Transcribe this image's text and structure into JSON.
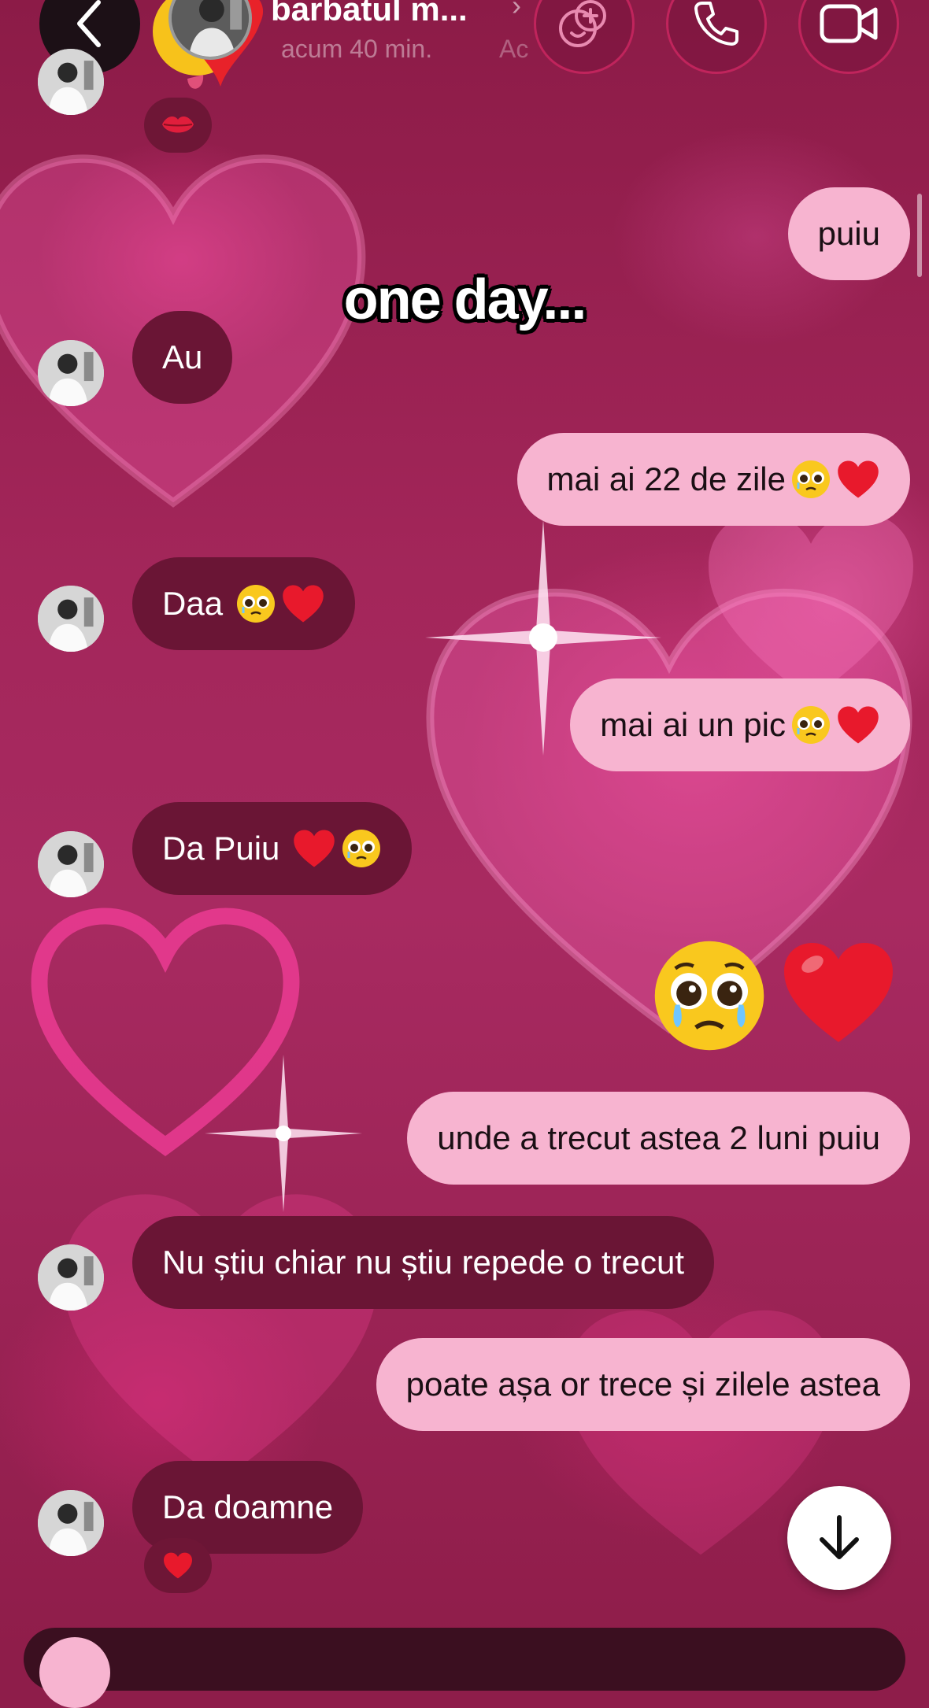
{
  "header": {
    "title": "barbatul m...",
    "status": "acum 40 min.",
    "status_extra": "Ac",
    "back_icon": "chevron-left-icon",
    "actions": [
      "effects-icon",
      "phone-icon",
      "video-camera-icon"
    ]
  },
  "overlay_caption": "one day...",
  "messages": [
    {
      "side": "mine",
      "text": "puiu"
    },
    {
      "side": "theirs",
      "text": "Au"
    },
    {
      "side": "mine",
      "text": "mai ai 22 de zile",
      "emoji": [
        "pleading-face",
        "red-heart"
      ]
    },
    {
      "side": "theirs",
      "text": "Daa",
      "emoji": [
        "pleading-face",
        "red-heart"
      ]
    },
    {
      "side": "mine",
      "text": "mai ai un pic",
      "emoji": [
        "pleading-face",
        "red-heart"
      ]
    },
    {
      "side": "theirs",
      "text": "Da Puiu",
      "emoji": [
        "red-heart",
        "pleading-face"
      ]
    },
    {
      "side": "mine",
      "emoji_only": [
        "pleading-face",
        "red-heart"
      ]
    },
    {
      "side": "mine",
      "text": "unde a trecut astea 2 luni puiu"
    },
    {
      "side": "theirs",
      "text": "Nu știu chiar nu știu repede o trecut"
    },
    {
      "side": "mine",
      "text": "poate așa or trece și zilele astea"
    },
    {
      "side": "theirs",
      "text": "Da doamne"
    }
  ],
  "reactions": {
    "top": "kiss-mark",
    "last_message": "red-heart"
  },
  "colors": {
    "background": "#a3265a",
    "mine_bubble": "#f7b4d0",
    "theirs_bubble": "#6a1535"
  }
}
